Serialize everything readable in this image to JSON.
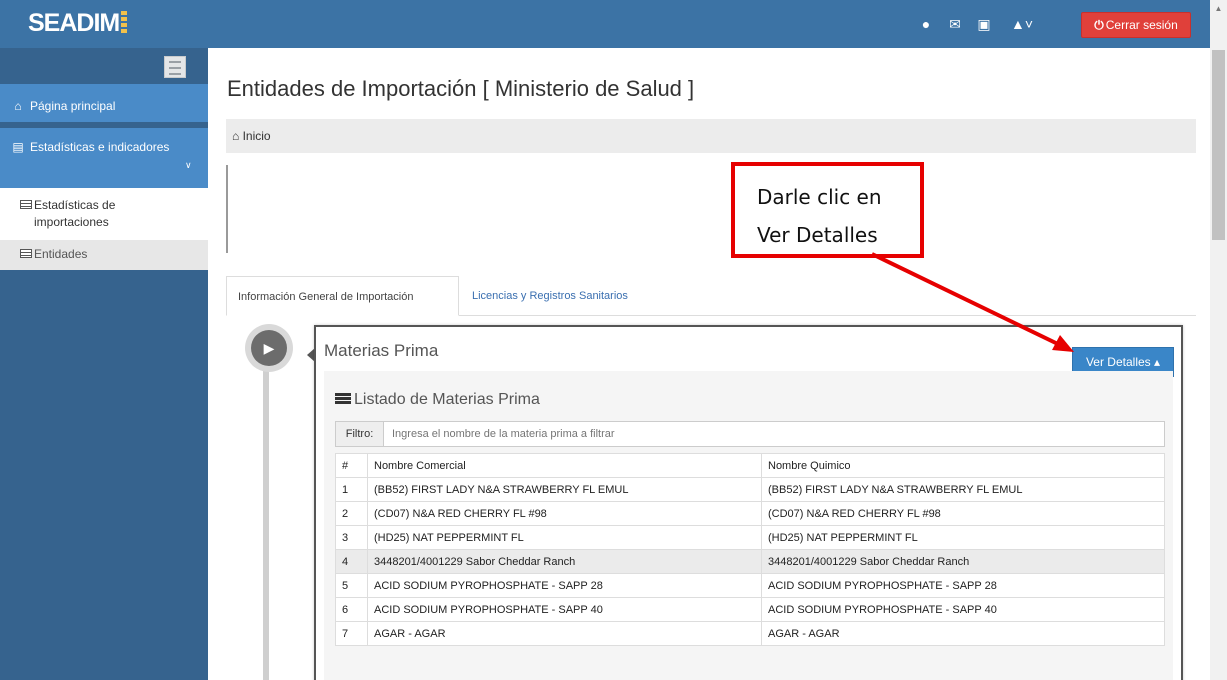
{
  "app": {
    "brand": "SEADIM"
  },
  "header": {
    "icons": [
      "chat-icon",
      "envelope-icon",
      "money-icon",
      "user-icon"
    ],
    "logout_label": "Cerrar sesión"
  },
  "sidebar": {
    "items": [
      {
        "label": "Página principal",
        "icon": "home-icon"
      },
      {
        "label": "Estadísticas e indicadores",
        "icon": "file-icon"
      }
    ],
    "subitems": [
      {
        "label": "Estadísticas de importaciones"
      },
      {
        "label": "Entidades"
      }
    ]
  },
  "main": {
    "title": "Entidades de Importación [ Ministerio de Salud ]",
    "breadcrumb": "Inicio",
    "tabs": [
      {
        "label": "Información General de Importación"
      },
      {
        "label": "Licencias y Registros Sanitarios"
      }
    ]
  },
  "annotation": {
    "line1": "Darle clic en",
    "line2": "Ver Detalles"
  },
  "panel": {
    "title": "Materias Prima",
    "detail_button": "Ver Detalles",
    "list_title": "Listado de Materias Prima",
    "filter_label": "Filtro:",
    "filter_placeholder": "Ingresa el nombre de la materia prima a filtrar",
    "columns": [
      "#",
      "Nombre Comercial",
      "Nombre Quimico"
    ],
    "rows": [
      [
        "1",
        "(BB52) FIRST LADY N&A STRAWBERRY FL EMUL",
        "(BB52) FIRST LADY N&A STRAWBERRY FL EMUL"
      ],
      [
        "2",
        "(CD07) N&A RED CHERRY FL #98",
        "(CD07) N&A RED CHERRY FL #98"
      ],
      [
        "3",
        "(HD25) NAT PEPPERMINT FL",
        "(HD25) NAT PEPPERMINT FL"
      ],
      [
        "4",
        "3448201/4001229 Sabor Cheddar Ranch",
        "3448201/4001229 Sabor Cheddar Ranch"
      ],
      [
        "5",
        "ACID SODIUM PYROPHOSPHATE - SAPP 28",
        "ACID SODIUM PYROPHOSPHATE - SAPP 28"
      ],
      [
        "6",
        "ACID SODIUM PYROPHOSPHATE - SAPP 40",
        "ACID SODIUM PYROPHOSPHATE - SAPP 40"
      ],
      [
        "7",
        "AGAR - AGAR",
        "AGAR - AGAR"
      ]
    ]
  }
}
